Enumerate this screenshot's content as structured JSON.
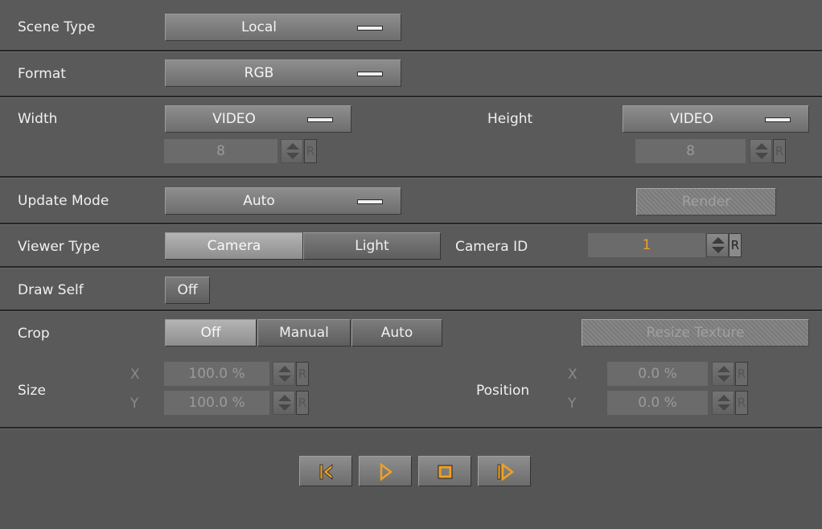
{
  "scene_type": {
    "label": "Scene Type",
    "value": "Local"
  },
  "format": {
    "label": "Format",
    "value": "RGB"
  },
  "width": {
    "label": "Width",
    "mode": "VIDEO",
    "value": "8"
  },
  "height": {
    "label": "Height",
    "mode": "VIDEO",
    "value": "8"
  },
  "update_mode": {
    "label": "Update Mode",
    "value": "Auto",
    "render_label": "Render"
  },
  "viewer_type": {
    "label": "Viewer Type",
    "options": [
      "Camera",
      "Light"
    ],
    "selected": "Camera"
  },
  "camera_id": {
    "label": "Camera ID",
    "value": "1"
  },
  "draw_self": {
    "label": "Draw Self",
    "value": "Off"
  },
  "crop": {
    "label": "Crop",
    "options": [
      "Off",
      "Manual",
      "Auto"
    ],
    "selected": "Off",
    "resize_label": "Resize Texture"
  },
  "size": {
    "label": "Size",
    "x_label": "X",
    "y_label": "Y",
    "x_value": "100.0 %",
    "y_value": "100.0 %"
  },
  "position": {
    "label": "Position",
    "x_label": "X",
    "y_label": "Y",
    "x_value": "0.0 %",
    "y_value": "0.0 %"
  },
  "reset_label": "R",
  "transport": {
    "buttons": [
      "skip-to-start",
      "play",
      "stop",
      "step-forward"
    ],
    "accent_color": "#f0a020"
  },
  "colors": {
    "panel": "#5a5a5a",
    "separator": "#262626",
    "accent": "#f0a030"
  }
}
